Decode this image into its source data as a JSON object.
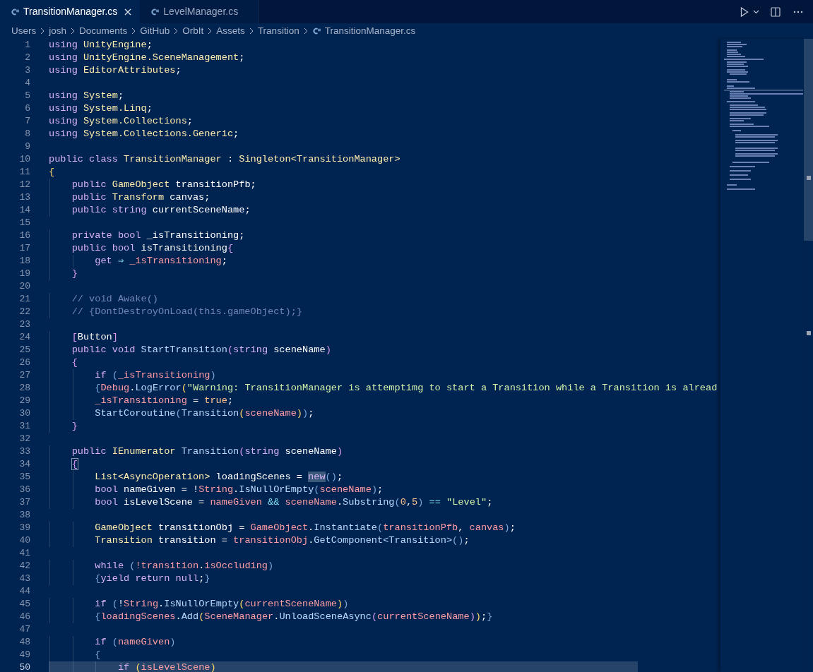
{
  "tabs": [
    {
      "label": "TransitionManager.cs",
      "selected": true
    },
    {
      "label": "LevelManager.cs",
      "selected": false
    }
  ],
  "breadcrumb": [
    "Users",
    "josh",
    "Documents",
    "GitHub",
    "OrbIt",
    "Assets",
    "Transition",
    "TransitionManager.cs"
  ],
  "editor": {
    "lines": [
      {
        "number": "1",
        "current": false,
        "tokens": [
          {
            "text": "using ",
            "kind": "kw"
          },
          {
            "text": "UnityEngine",
            "kind": "type"
          },
          {
            "text": ";",
            "kind": "p"
          }
        ]
      },
      {
        "number": "2",
        "current": false,
        "tokens": [
          {
            "text": "using ",
            "kind": "kw"
          },
          {
            "text": "UnityEngine.SceneManagement",
            "kind": "type"
          },
          {
            "text": ";",
            "kind": "p"
          }
        ]
      },
      {
        "number": "3",
        "current": false,
        "tokens": [
          {
            "text": "using ",
            "kind": "kw"
          },
          {
            "text": "EditorAttributes",
            "kind": "type"
          },
          {
            "text": ";",
            "kind": "p"
          }
        ]
      },
      {
        "number": "4",
        "current": false
      },
      {
        "number": "5",
        "current": false,
        "tokens": [
          {
            "text": "using ",
            "kind": "kw"
          },
          {
            "text": "System",
            "kind": "type"
          },
          {
            "text": ";",
            "kind": "p"
          }
        ]
      },
      {
        "number": "6",
        "current": false,
        "tokens": [
          {
            "text": "using ",
            "kind": "kw"
          },
          {
            "text": "System.Linq",
            "kind": "type"
          },
          {
            "text": ";",
            "kind": "p"
          }
        ]
      },
      {
        "number": "7",
        "current": false,
        "tokens": [
          {
            "text": "using ",
            "kind": "kw"
          },
          {
            "text": "System.Collections",
            "kind": "type"
          },
          {
            "text": ";",
            "kind": "p"
          }
        ]
      },
      {
        "number": "8",
        "current": false,
        "tokens": [
          {
            "text": "using ",
            "kind": "kw"
          },
          {
            "text": "System.Collections.Generic",
            "kind": "type"
          },
          {
            "text": ";",
            "kind": "p"
          }
        ]
      },
      {
        "number": "9",
        "current": false
      },
      {
        "number": "10",
        "current": false,
        "tokens": [
          {
            "text": "public class ",
            "kind": "kw"
          },
          {
            "text": "TransitionManager ",
            "kind": "type"
          },
          {
            "text": ": ",
            "kind": "p"
          },
          {
            "text": "Singleton<TransitionManager>",
            "kind": "type"
          }
        ]
      },
      {
        "number": "11",
        "current": false,
        "tokens": [
          {
            "text": "{",
            "kind": "b1"
          }
        ]
      },
      {
        "number": "12",
        "current": false,
        "tokens": [
          {
            "text": "    public ",
            "kind": "kw"
          },
          {
            "text": "GameObject ",
            "kind": "type"
          },
          {
            "text": "transitionPfb;",
            "kind": "p"
          }
        ]
      },
      {
        "number": "13",
        "current": false,
        "tokens": [
          {
            "text": "    public ",
            "kind": "kw"
          },
          {
            "text": "Transform ",
            "kind": "type"
          },
          {
            "text": "canvas;",
            "kind": "p"
          }
        ]
      },
      {
        "number": "14",
        "current": false,
        "tokens": [
          {
            "text": "    public string ",
            "kind": "kw"
          },
          {
            "text": "currentSceneName;",
            "kind": "p"
          }
        ]
      },
      {
        "number": "15",
        "current": false
      },
      {
        "number": "16",
        "current": false,
        "tokens": [
          {
            "text": "    private bool ",
            "kind": "kw"
          },
          {
            "text": "_isTransitioning;",
            "kind": "p"
          }
        ]
      },
      {
        "number": "17",
        "current": false,
        "tokens": [
          {
            "text": "    public bool ",
            "kind": "kw"
          },
          {
            "text": "isTransitioning",
            "kind": "p"
          },
          {
            "text": "{",
            "kind": "b2"
          }
        ]
      },
      {
        "number": "18",
        "current": false,
        "tokens": [
          {
            "text": "        get ",
            "kind": "kw"
          },
          {
            "text": "⇒ ",
            "kind": "op"
          },
          {
            "text": "_isTransitioning",
            "kind": "var"
          },
          {
            "text": ";",
            "kind": "p"
          }
        ]
      },
      {
        "number": "19",
        "current": false,
        "tokens": [
          {
            "text": "    }",
            "kind": "b2"
          }
        ]
      },
      {
        "number": "20",
        "current": false
      },
      {
        "number": "21",
        "current": false,
        "tokens": [
          {
            "text": "    // void Awake()",
            "kind": "comment"
          }
        ]
      },
      {
        "number": "22",
        "current": false,
        "tokens": [
          {
            "text": "    // {DontDestroyOnLoad(this.gameObject);}",
            "kind": "comment"
          }
        ]
      },
      {
        "number": "23",
        "current": false
      },
      {
        "number": "24",
        "current": false,
        "tokens": [
          {
            "text": "    [",
            "kind": "b2"
          },
          {
            "text": "Button",
            "kind": "p"
          },
          {
            "text": "]",
            "kind": "b2"
          }
        ]
      },
      {
        "number": "25",
        "current": false,
        "tokens": [
          {
            "text": "    public void ",
            "kind": "kw"
          },
          {
            "text": "StartTransition",
            "kind": "fn"
          },
          {
            "text": "(",
            "kind": "b2"
          },
          {
            "text": "string ",
            "kind": "kw"
          },
          {
            "text": "sceneName",
            "kind": "p"
          },
          {
            "text": ")",
            "kind": "b2"
          }
        ]
      },
      {
        "number": "26",
        "current": false,
        "tokens": [
          {
            "text": "    {",
            "kind": "b2"
          }
        ]
      },
      {
        "number": "27",
        "current": false,
        "tokens": [
          {
            "text": "        if ",
            "kind": "kw"
          },
          {
            "text": "(",
            "kind": "b3"
          },
          {
            "text": "_isTransitioning",
            "kind": "var"
          },
          {
            "text": ")",
            "kind": "b3"
          }
        ]
      },
      {
        "number": "28",
        "current": false,
        "tokens": [
          {
            "text": "        {",
            "kind": "b3"
          },
          {
            "text": "Debug",
            "kind": "var"
          },
          {
            "text": ".",
            "kind": "p"
          },
          {
            "text": "LogError",
            "kind": "fn"
          },
          {
            "text": "(",
            "kind": "b1"
          },
          {
            "text": "\"Warning: TransitionManager is attemptimg to start a Transition while a Transition is alread",
            "kind": "string"
          }
        ]
      },
      {
        "number": "29",
        "current": false,
        "tokens": [
          {
            "text": "        _isTransitioning",
            "kind": "var"
          },
          {
            "text": " = ",
            "kind": "p"
          },
          {
            "text": "true",
            "kind": "num"
          },
          {
            "text": ";",
            "kind": "p"
          }
        ]
      },
      {
        "number": "30",
        "current": false,
        "tokens": [
          {
            "text": "        StartCoroutine",
            "kind": "fn"
          },
          {
            "text": "(",
            "kind": "b3"
          },
          {
            "text": "Transition",
            "kind": "fn"
          },
          {
            "text": "(",
            "kind": "b1"
          },
          {
            "text": "sceneName",
            "kind": "var"
          },
          {
            "text": ")",
            "kind": "b1"
          },
          {
            "text": ")",
            "kind": "b3"
          },
          {
            "text": ";",
            "kind": "p"
          }
        ]
      },
      {
        "number": "31",
        "current": false,
        "tokens": [
          {
            "text": "    }",
            "kind": "b2"
          }
        ]
      },
      {
        "number": "32",
        "current": false
      },
      {
        "number": "33",
        "current": false,
        "tokens": [
          {
            "text": "    public ",
            "kind": "kw"
          },
          {
            "text": "IEnumerator ",
            "kind": "type"
          },
          {
            "text": "Transition",
            "kind": "fn"
          },
          {
            "text": "(",
            "kind": "b2"
          },
          {
            "text": "string ",
            "kind": "kw"
          },
          {
            "text": "sceneName",
            "kind": "p"
          },
          {
            "text": ")",
            "kind": "b2"
          }
        ]
      },
      {
        "number": "34",
        "current": false,
        "tokens": [
          {
            "text": "    {",
            "kind": "match"
          }
        ]
      },
      {
        "number": "35",
        "current": false,
        "tokens": [
          {
            "text": "        List<AsyncOperation> ",
            "kind": "type"
          },
          {
            "text": "loadingScenes = ",
            "kind": "p"
          },
          {
            "text": "new",
            "kind": "hl"
          },
          {
            "text": "(",
            "kind": "b3"
          },
          {
            "text": ")",
            "kind": "b3"
          },
          {
            "text": ";",
            "kind": "p"
          }
        ]
      },
      {
        "number": "36",
        "current": false,
        "tokens": [
          {
            "text": "        bool ",
            "kind": "kw"
          },
          {
            "text": "nameGiven = !",
            "kind": "p"
          },
          {
            "text": "String",
            "kind": "var"
          },
          {
            "text": ".",
            "kind": "p"
          },
          {
            "text": "IsNullOrEmpty",
            "kind": "fn"
          },
          {
            "text": "(",
            "kind": "b3"
          },
          {
            "text": "sceneName",
            "kind": "var"
          },
          {
            "text": ")",
            "kind": "b3"
          },
          {
            "text": ";",
            "kind": "p"
          }
        ]
      },
      {
        "number": "37",
        "current": false,
        "tokens": [
          {
            "text": "        bool ",
            "kind": "kw"
          },
          {
            "text": "isLevelScene = ",
            "kind": "p"
          },
          {
            "text": "nameGiven",
            "kind": "var"
          },
          {
            "text": " && ",
            "kind": "op"
          },
          {
            "text": "sceneName",
            "kind": "var"
          },
          {
            "text": ".",
            "kind": "p"
          },
          {
            "text": "Substring",
            "kind": "fn"
          },
          {
            "text": "(",
            "kind": "b3"
          },
          {
            "text": "0",
            "kind": "num"
          },
          {
            "text": ",",
            "kind": "p"
          },
          {
            "text": "5",
            "kind": "num"
          },
          {
            "text": ")",
            "kind": "b3"
          },
          {
            "text": " == ",
            "kind": "op"
          },
          {
            "text": "\"Level\"",
            "kind": "string"
          },
          {
            "text": ";",
            "kind": "p"
          }
        ]
      },
      {
        "number": "38",
        "current": false
      },
      {
        "number": "39",
        "current": false,
        "tokens": [
          {
            "text": "        GameObject ",
            "kind": "type"
          },
          {
            "text": "transitionObj = ",
            "kind": "p"
          },
          {
            "text": "GameObject",
            "kind": "var"
          },
          {
            "text": ".",
            "kind": "p"
          },
          {
            "text": "Instantiate",
            "kind": "fn"
          },
          {
            "text": "(",
            "kind": "b3"
          },
          {
            "text": "transitionPfb",
            "kind": "var"
          },
          {
            "text": ", ",
            "kind": "p"
          },
          {
            "text": "canvas",
            "kind": "var"
          },
          {
            "text": ")",
            "kind": "b3"
          },
          {
            "text": ";",
            "kind": "p"
          }
        ]
      },
      {
        "number": "40",
        "current": false,
        "tokens": [
          {
            "text": "        Transition ",
            "kind": "type"
          },
          {
            "text": "transition = ",
            "kind": "p"
          },
          {
            "text": "transitionObj",
            "kind": "var"
          },
          {
            "text": ".",
            "kind": "p"
          },
          {
            "text": "GetComponent<Transition>",
            "kind": "fn"
          },
          {
            "text": "(",
            "kind": "b3"
          },
          {
            "text": ")",
            "kind": "b3"
          },
          {
            "text": ";",
            "kind": "p"
          }
        ]
      },
      {
        "number": "41",
        "current": false
      },
      {
        "number": "42",
        "current": false,
        "tokens": [
          {
            "text": "        while ",
            "kind": "kw"
          },
          {
            "text": "(",
            "kind": "b3"
          },
          {
            "text": "!transition",
            "kind": "var"
          },
          {
            "text": ".",
            "kind": "p"
          },
          {
            "text": "isOccluding",
            "kind": "var"
          },
          {
            "text": ")",
            "kind": "b3"
          }
        ]
      },
      {
        "number": "43",
        "current": false,
        "tokens": [
          {
            "text": "        {",
            "kind": "b3"
          },
          {
            "text": "yield return null",
            "kind": "kw"
          },
          {
            "text": ";",
            "kind": "p"
          },
          {
            "text": "}",
            "kind": "b3"
          }
        ]
      },
      {
        "number": "44",
        "current": false
      },
      {
        "number": "45",
        "current": false,
        "tokens": [
          {
            "text": "        if ",
            "kind": "kw"
          },
          {
            "text": "(",
            "kind": "b3"
          },
          {
            "text": "!",
            "kind": "p"
          },
          {
            "text": "String",
            "kind": "var"
          },
          {
            "text": ".",
            "kind": "p"
          },
          {
            "text": "IsNullOrEmpty",
            "kind": "fn"
          },
          {
            "text": "(",
            "kind": "b1"
          },
          {
            "text": "currentSceneName",
            "kind": "var"
          },
          {
            "text": ")",
            "kind": "b1"
          },
          {
            "text": ")",
            "kind": "b3"
          }
        ]
      },
      {
        "number": "46",
        "current": false,
        "tokens": [
          {
            "text": "        {",
            "kind": "b3"
          },
          {
            "text": "loadingScenes",
            "kind": "var"
          },
          {
            "text": ".",
            "kind": "p"
          },
          {
            "text": "Add",
            "kind": "fn"
          },
          {
            "text": "(",
            "kind": "b1"
          },
          {
            "text": "SceneManager",
            "kind": "var"
          },
          {
            "text": ".",
            "kind": "p"
          },
          {
            "text": "UnloadSceneAsync",
            "kind": "fn"
          },
          {
            "text": "(",
            "kind": "b2"
          },
          {
            "text": "currentSceneName",
            "kind": "var"
          },
          {
            "text": ")",
            "kind": "b2"
          },
          {
            "text": ")",
            "kind": "b1"
          },
          {
            "text": ";",
            "kind": "p"
          },
          {
            "text": "}",
            "kind": "b3"
          }
        ]
      },
      {
        "number": "47",
        "current": false
      },
      {
        "number": "48",
        "current": false,
        "tokens": [
          {
            "text": "        if ",
            "kind": "kw"
          },
          {
            "text": "(",
            "kind": "b3"
          },
          {
            "text": "nameGiven",
            "kind": "var"
          },
          {
            "text": ")",
            "kind": "b3"
          }
        ]
      },
      {
        "number": "49",
        "current": false,
        "tokens": [
          {
            "text": "        {",
            "kind": "b3"
          }
        ]
      },
      {
        "number": "50",
        "current": true,
        "tokens": [
          {
            "text": "            if ",
            "kind": "kw"
          },
          {
            "text": "(",
            "kind": "b1"
          },
          {
            "text": "isLevelScene",
            "kind": "var"
          },
          {
            "text": ")",
            "kind": "b1"
          }
        ]
      }
    ]
  }
}
